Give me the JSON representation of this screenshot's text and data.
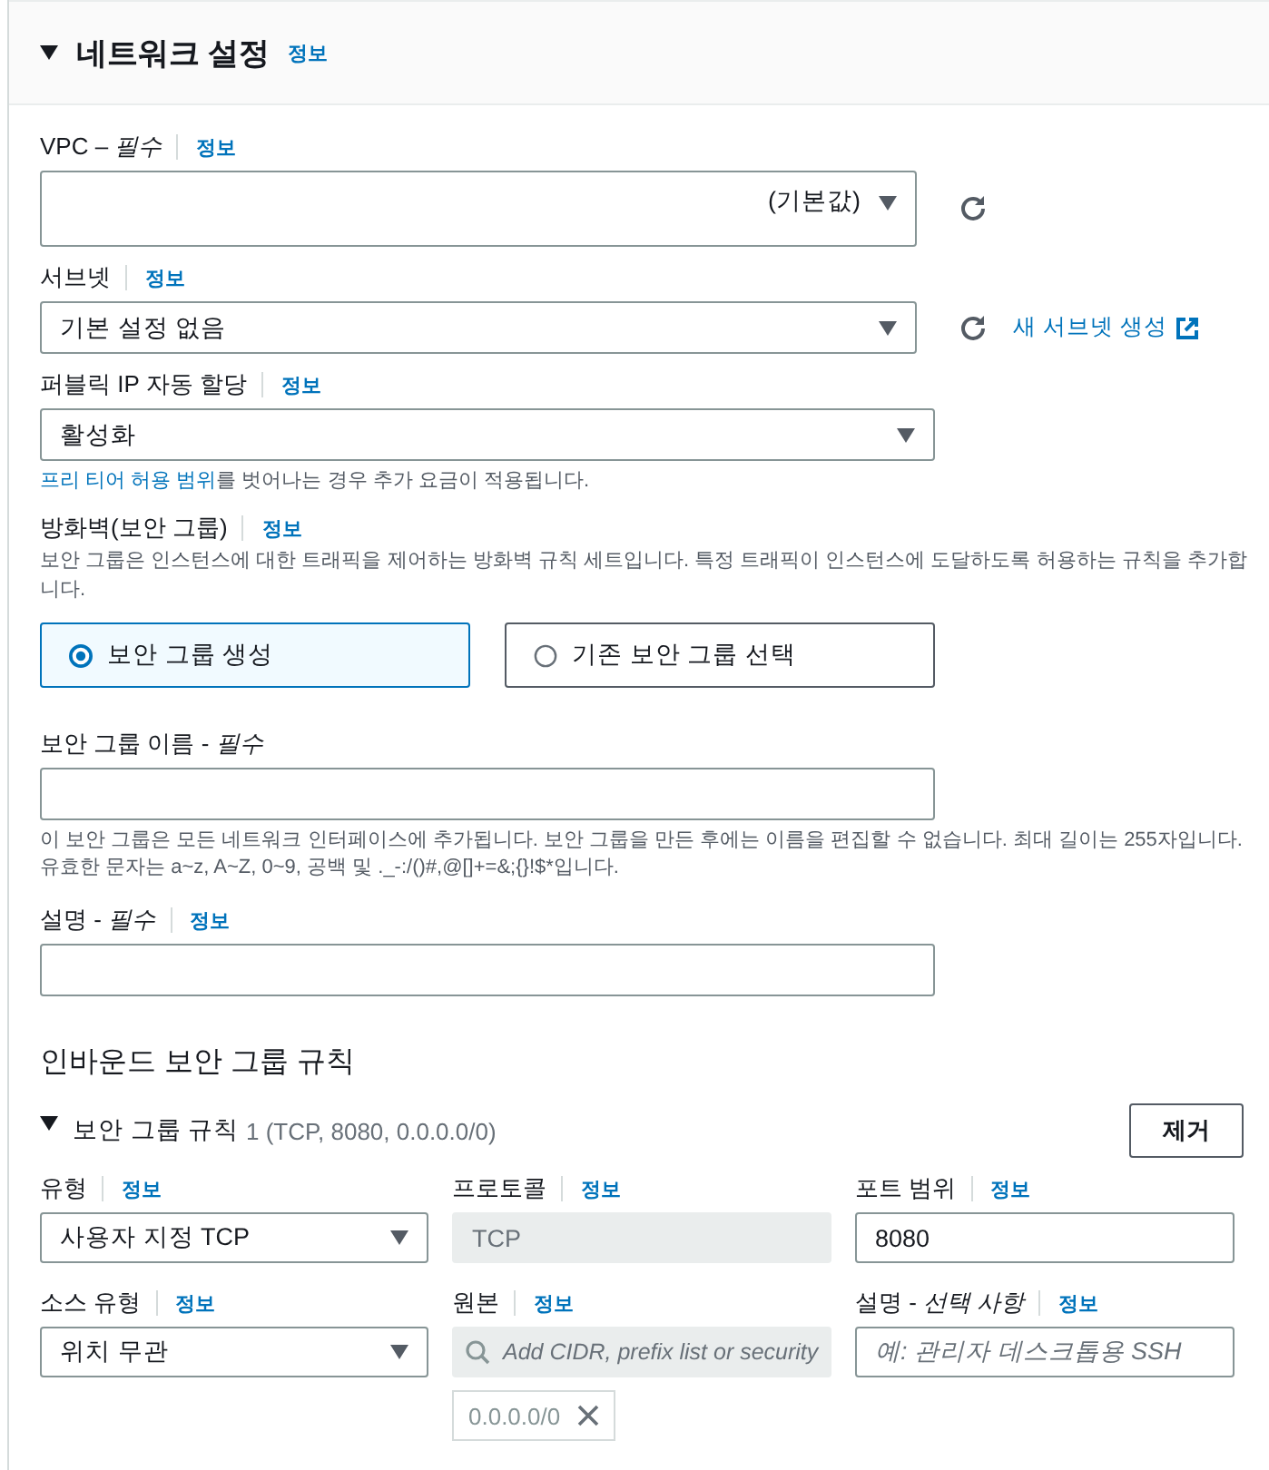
{
  "section": {
    "title": "네트워크 설정",
    "info": "정보",
    "expanded": true
  },
  "vpc": {
    "label": "VPC – *필수*",
    "info": "정보",
    "suffix": "(기본값)"
  },
  "subnet": {
    "label": "서브넷",
    "info": "정보",
    "value": "기본 설정 없음",
    "link": "새 서브넷 생성"
  },
  "public_ip": {
    "label": "퍼블릭 IP 자동 할당",
    "info": "정보",
    "value": "활성화",
    "help_link": "프리 티어 허용 범위",
    "help_text": "를 벗어나는 경우 추가 요금이 적용됩니다."
  },
  "firewall": {
    "label": "방화벽(보안 그룹)",
    "info": "정보",
    "description": "보안 그룹은 인스턴스에 대한 트래픽을 제어하는 방화벽 규칙 세트입니다. 특정 트래픽이 인스턴스에 도달하도록 허용하는 규칙을 추가합니다.",
    "options": [
      {
        "label": "보안 그룹 생성",
        "selected": true
      },
      {
        "label": "기존 보안 그룹 선택",
        "selected": false
      }
    ]
  },
  "group_name": {
    "label": "보안 그룹 이름 - *필수*",
    "help": "이 보안 그룹은 모든 네트워크 인터페이스에 추가됩니다. 보안 그룹을 만든 후에는 이름을 편집할 수 없습니다. 최대 길이는 255자입니다. 유효한 문자는 a~z, A~Z, 0~9, 공백 및 ._-:/()#,@[]+=&;{}!$*입니다."
  },
  "description": {
    "label": "설명 - *필수*",
    "info": "정보"
  },
  "inbound": {
    "title": "인바운드 보안 그룹 규칙",
    "rule": {
      "title": "보안 그룹 규칙",
      "summary": "1 (TCP, 8080, 0.0.0.0/0)",
      "expanded": true,
      "remove": "제거",
      "fields": [
        {
          "kind": "select",
          "label": "유형",
          "info": "정보",
          "value": "사용자 지정 TCP"
        },
        {
          "kind": "readonly",
          "label": "프로토콜",
          "info": "정보",
          "value": "TCP"
        },
        {
          "kind": "input",
          "label": "포트 범위",
          "info": "정보",
          "value": "8080"
        },
        {
          "kind": "select",
          "label": "소스 유형",
          "info": "정보",
          "value": "위치 무관"
        },
        {
          "kind": "search",
          "label": "원본",
          "info": "정보",
          "placeholder": "Add CIDR, prefix list or security",
          "token": "0.0.0.0/0"
        },
        {
          "kind": "input",
          "label": "설명 - *선택 사항*",
          "info": "정보",
          "placeholder": "예: 관리자 데스크톱용 SSH"
        }
      ]
    }
  }
}
